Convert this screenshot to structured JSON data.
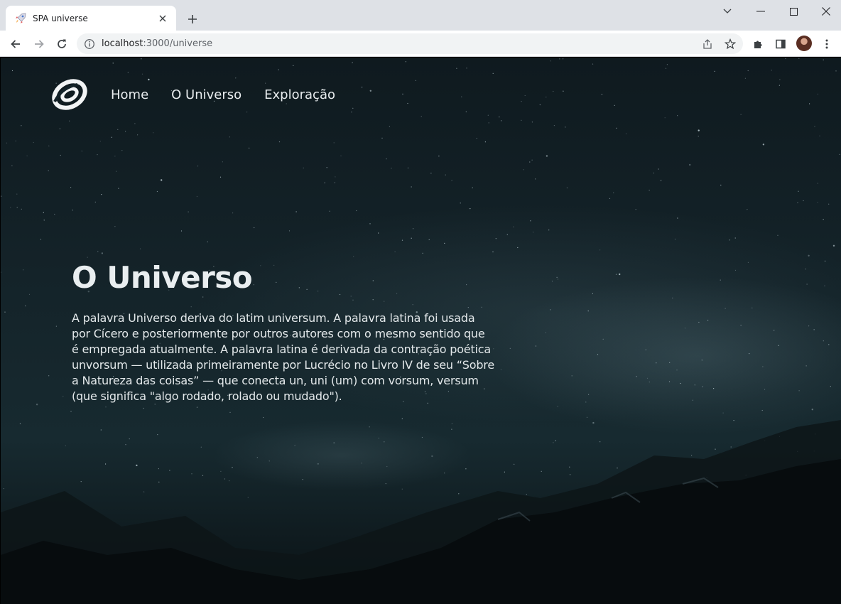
{
  "browser": {
    "tab_title": "SPA universe",
    "url_host": "localhost",
    "url_path": ":3000/universe",
    "icons": {
      "favicon": "rocket-icon",
      "tab_close": "close-icon",
      "new_tab": "plus-icon",
      "back": "arrow-left-icon",
      "forward": "arrow-right-icon",
      "reload": "reload-icon",
      "site_info": "info-icon",
      "share": "share-icon",
      "bookmark": "star-icon",
      "extensions": "puzzle-icon",
      "side_panel": "sidepanel-icon",
      "menu": "kebab-menu-icon"
    }
  },
  "nav": {
    "items": [
      {
        "label": "Home"
      },
      {
        "label": "O Universo"
      },
      {
        "label": "Exploração"
      }
    ]
  },
  "hero": {
    "title": "O Universo",
    "paragraph_lines": [
      "A palavra Universo deriva do latim universum. A palavra latina foi usada",
      "por Cícero e posteriormente por outros autores com o mesmo sentido que",
      "é empregada atualmente. A palavra latina é derivada da contração poética",
      "unvorsum — utilizada primeiramente por Lucrécio no Livro IV de seu “Sobre",
      "a Natureza das coisas” — que conecta un, uni (um) com vorsum, versum",
      "(que significa \"algo rodado, rolado ou mudado\")."
    ]
  },
  "colors": {
    "chrome_tabbar": "#dee1e6",
    "page_text": "#e9eef0",
    "night_sky": "#142329"
  }
}
